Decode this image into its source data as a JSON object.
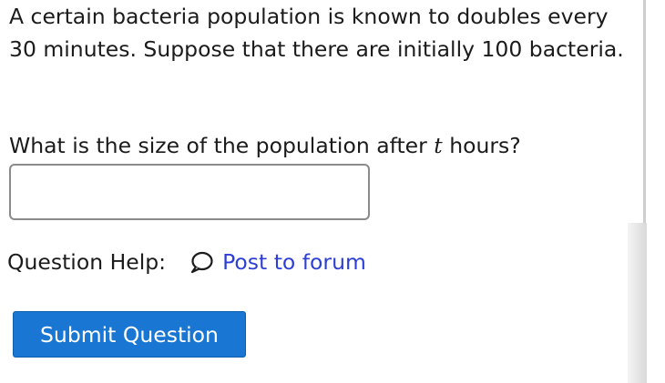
{
  "question": {
    "text": "A certain bacteria population is known to doubles every 30 minutes. Suppose that there are initially 100 bacteria.",
    "prompt_before": "What is the size of the population after",
    "prompt_variable": "t",
    "prompt_after": "hours?"
  },
  "answer": {
    "value": "",
    "placeholder": ""
  },
  "help": {
    "label": "Question Help:",
    "icon": "speech-bubble-icon",
    "forum_link": "Post to forum"
  },
  "submit": {
    "label": "Submit Question"
  },
  "colors": {
    "link": "#2d3fd6",
    "submit_bg": "#1976d2",
    "text": "#1b1b1b"
  }
}
